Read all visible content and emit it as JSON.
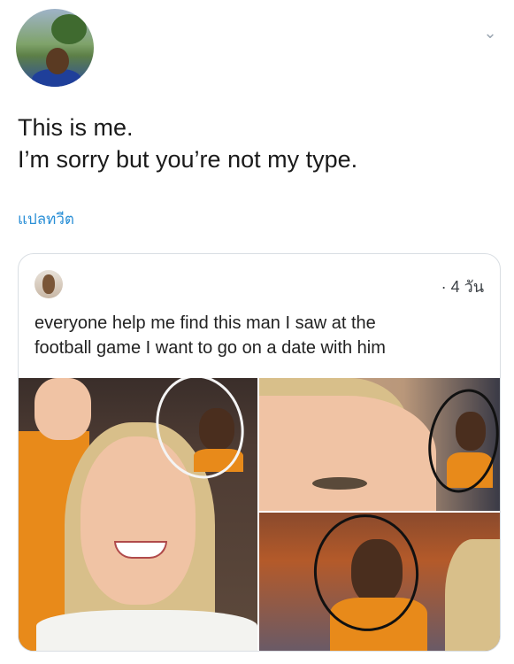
{
  "tweet": {
    "lines": [
      "This is me.",
      "I’m sorry but you’re not my type."
    ],
    "translate_label": "แปลทวีต",
    "caret_icon": "chevron-down-icon"
  },
  "quoted_tweet": {
    "time": "· 4 วัน",
    "text_lines": [
      "everyone help me find this man I saw at the",
      "football game I want to go on a date with him"
    ],
    "media_count": 3
  },
  "colors": {
    "link": "#2a8fd6",
    "text": "#1a1a1a",
    "border": "#d9dee3"
  }
}
